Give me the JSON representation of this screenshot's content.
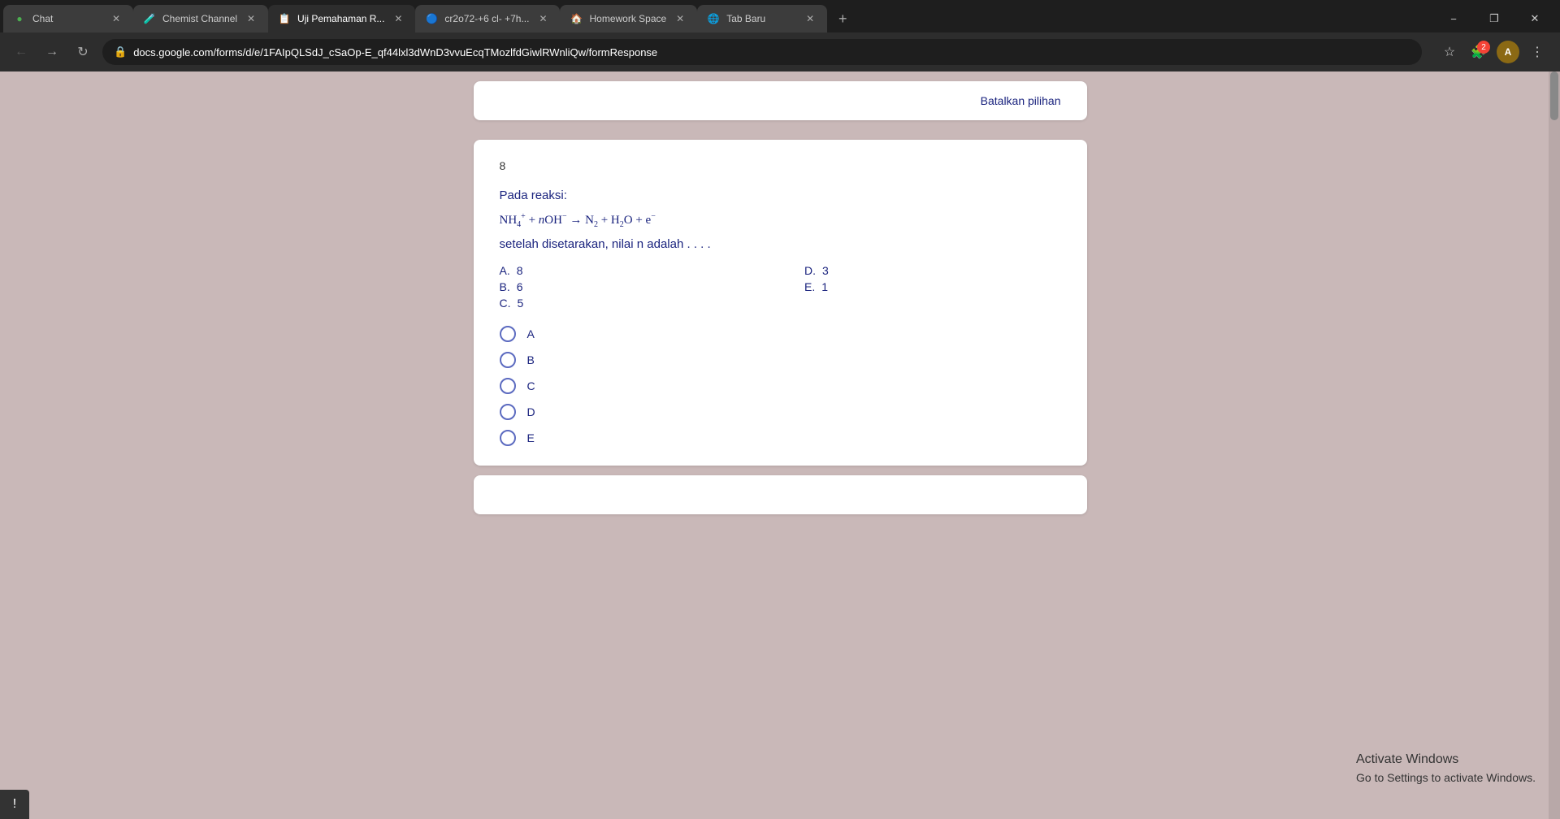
{
  "browser": {
    "tabs": [
      {
        "id": "chat",
        "favicon": "💬",
        "label": "Chat",
        "active": false,
        "favicon_color": "#4CAF50"
      },
      {
        "id": "chemist",
        "favicon": "🧪",
        "label": "Chemist Channel",
        "active": false
      },
      {
        "id": "uji",
        "favicon": "📋",
        "label": "Uji Pemahaman R...",
        "active": true
      },
      {
        "id": "cr2o72",
        "favicon": "🔵",
        "label": "cr2o72-+6 cl- +7h...",
        "active": false
      },
      {
        "id": "homework",
        "favicon": "🏠",
        "label": "Homework Space",
        "active": false
      },
      {
        "id": "newtab",
        "favicon": "🌐",
        "label": "Tab Baru",
        "active": false
      }
    ],
    "url": "docs.google.com/forms/d/e/1FAIpQLSdJ_cSaOp-E_qf44lxl3dWnD3vvuEcqTMozlfdGiwlRWnliQw/formResponse",
    "new_tab_label": "+",
    "window_controls": {
      "minimize": "−",
      "maximize": "❐",
      "close": "✕"
    }
  },
  "page": {
    "batalkan_label": "Batalkan pilihan",
    "question": {
      "number": "8",
      "intro": "Pada reaksi:",
      "reaction": "NH₄⁺ + nOH⁻ → N₂ + H₂O + e⁻",
      "question_text": "setelah disetarakan, nilai n adalah . . . .",
      "options": [
        {
          "letter": "A",
          "value": "8"
        },
        {
          "letter": "B",
          "value": "6"
        },
        {
          "letter": "C",
          "value": "5"
        },
        {
          "letter": "D",
          "value": "3"
        },
        {
          "letter": "E",
          "value": "1"
        }
      ],
      "radio_options": [
        {
          "id": "A",
          "label": "A"
        },
        {
          "id": "B",
          "label": "B"
        },
        {
          "id": "C",
          "label": "C"
        },
        {
          "id": "D",
          "label": "D"
        },
        {
          "id": "E",
          "label": "E"
        }
      ]
    }
  },
  "activate_windows": {
    "title": "Activate Windows",
    "subtitle": "Go to Settings to activate Windows."
  }
}
